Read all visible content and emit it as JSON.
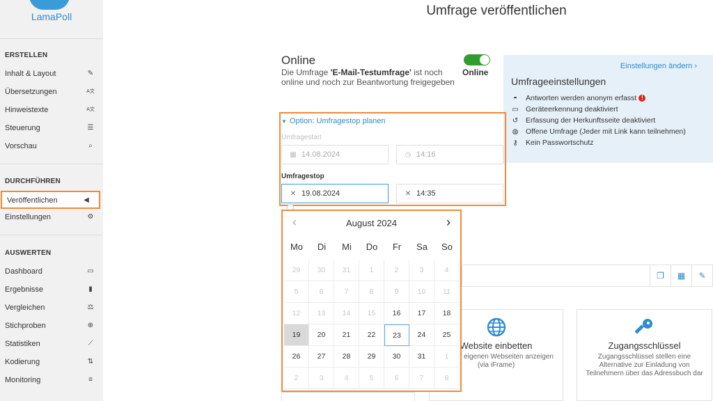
{
  "brand": {
    "logo_text": "LamaPoll"
  },
  "sidebar": {
    "section_create": "ERSTELLEN",
    "create_items": [
      {
        "label": "Inhalt & Layout",
        "icon": "pencil-icon"
      },
      {
        "label": "Übersetzungen",
        "icon": "translate-icon"
      },
      {
        "label": "Hinweistexte",
        "icon": "translate-icon"
      },
      {
        "label": "Steuerung",
        "icon": "sliders-icon"
      },
      {
        "label": "Vorschau",
        "icon": "search-icon"
      }
    ],
    "section_run": "DURCHFÜHREN",
    "run_items": [
      {
        "label": "Veröffentlichen",
        "icon": "megaphone-icon",
        "active": true
      },
      {
        "label": "Einstellungen",
        "icon": "gear-icon"
      }
    ],
    "section_analyze": "AUSWERTEN",
    "analyze_items": [
      {
        "label": "Dashboard",
        "icon": "tablet-icon"
      },
      {
        "label": "Ergebnisse",
        "icon": "bar-chart-icon"
      },
      {
        "label": "Vergleichen",
        "icon": "scale-icon"
      },
      {
        "label": "Stichproben",
        "icon": "zoom-icon"
      },
      {
        "label": "Statistiken",
        "icon": "line-chart-icon"
      },
      {
        "label": "Kodierung",
        "icon": "sort-icon"
      },
      {
        "label": "Monitoring",
        "icon": "list-icon"
      }
    ]
  },
  "main": {
    "title": "Umfrage veröffentlichen",
    "online": {
      "heading": "Online",
      "desc_prefix": "Die Umfrage ",
      "desc_name": "'E-Mail-Testumfrage'",
      "desc_suffix": " ist noch online und noch zur Beantwortung freigegeben",
      "toggle_label": "Online",
      "toggle_on": true
    },
    "settings": {
      "change_link": "Einstellungen ändern ›",
      "title": "Umfrageeinstellungen",
      "items": [
        {
          "icon": "anonymous-icon",
          "text": "Antworten werden anonym erfasst",
          "warning": true
        },
        {
          "icon": "laptop-icon",
          "text": "Geräteerkennung deaktiviert"
        },
        {
          "icon": "history-icon",
          "text": "Erfassung der Herkunftsseite deaktiviert"
        },
        {
          "icon": "globe-icon",
          "text": "Offene Umfrage (Jeder mit Link kann teilnehmen)"
        },
        {
          "icon": "key-icon",
          "text": "Kein Passwortschutz"
        }
      ]
    },
    "schedule": {
      "toggle_label": "Option: Umfragestop planen",
      "start_label": "Umfragestart",
      "start_date": "14.08.2024",
      "start_time": "14:16",
      "stop_label": "Umfragestop",
      "stop_date": "19.08.2024",
      "stop_time": "14:35"
    },
    "calendar": {
      "month_label": "August 2024",
      "weekdays": [
        "Mo",
        "Di",
        "Mi",
        "Do",
        "Fr",
        "Sa",
        "So"
      ],
      "weeks": [
        [
          "29",
          "30",
          "31",
          "1",
          "2",
          "3",
          "4"
        ],
        [
          "5",
          "6",
          "7",
          "8",
          "9",
          "10",
          "11"
        ],
        [
          "12",
          "13",
          "14",
          "15",
          "16",
          "17",
          "18"
        ],
        [
          "19",
          "20",
          "21",
          "22",
          "23",
          "24",
          "25"
        ],
        [
          "26",
          "27",
          "28",
          "29",
          "30",
          "31",
          "1"
        ],
        [
          "2",
          "3",
          "4",
          "5",
          "6",
          "7",
          "8"
        ]
      ],
      "selected": "19",
      "today": "23"
    },
    "cards": [
      {
        "title": "Website einbetten",
        "desc": "age auf eigenen Webseiten anzeigen (via iFrame)",
        "icon": "globe-icon"
      },
      {
        "title": "Zugangsschlüssel",
        "desc": "Zugangsschlüssel stellen eine Alternative zur Einladung von Teilnehmern über das Adressbuch dar",
        "icon": "key-icon"
      }
    ],
    "toolbar_icons": [
      "copy-icon",
      "qr-code-icon",
      "pencil-icon"
    ]
  }
}
